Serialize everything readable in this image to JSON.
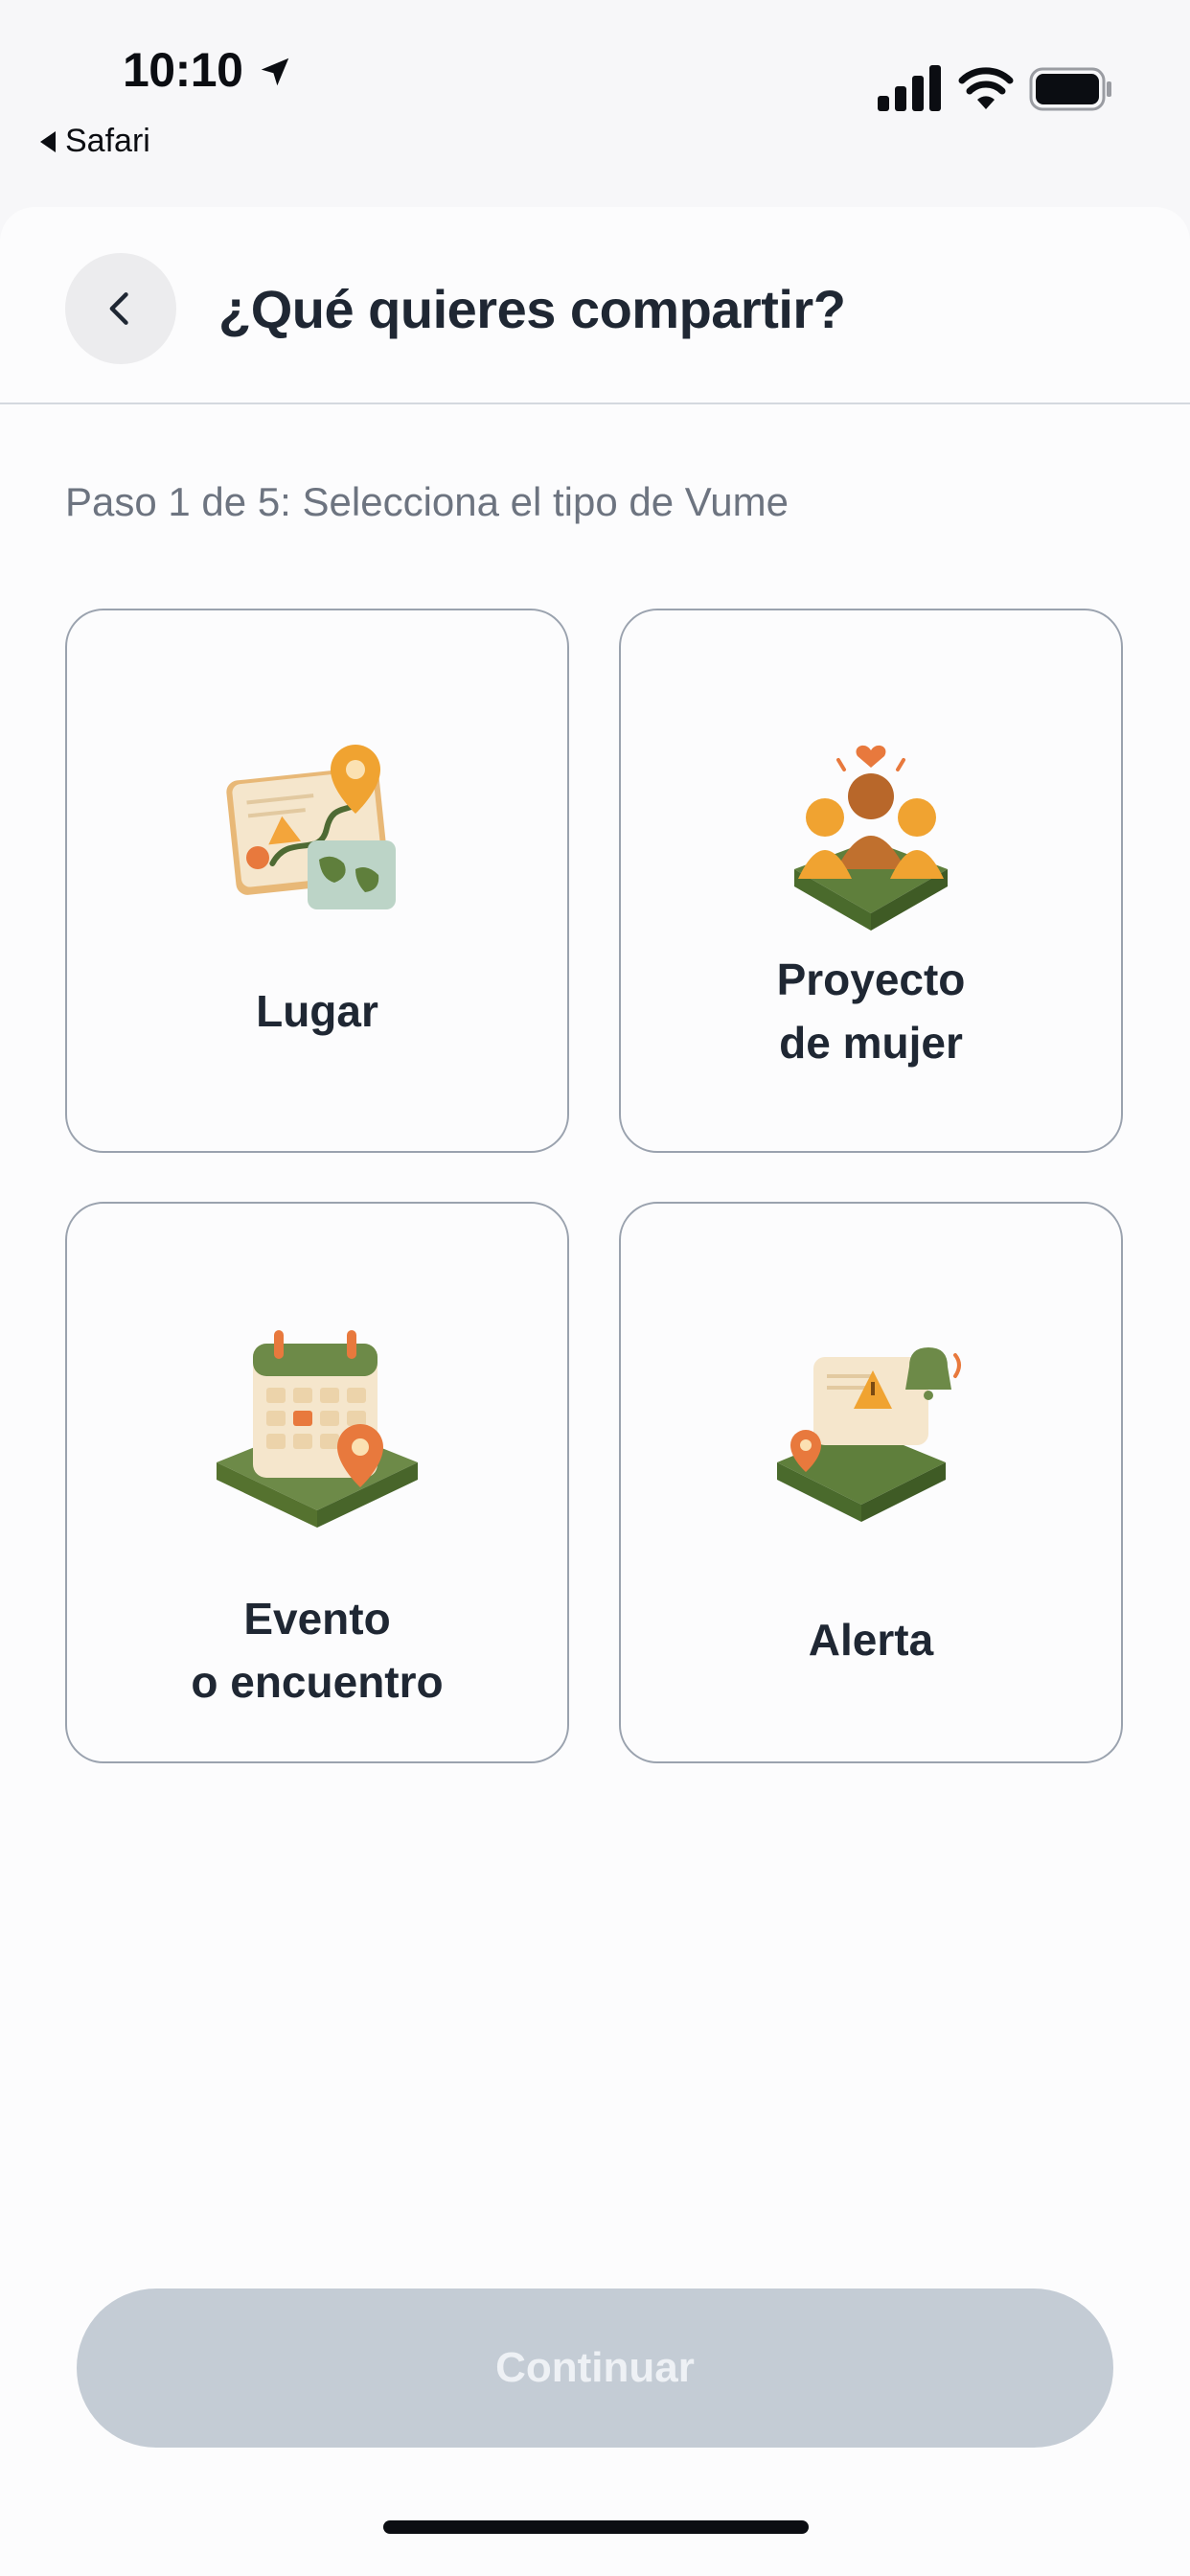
{
  "status_bar": {
    "time": "10:10",
    "back_app": "Safari",
    "icons": [
      "location-arrow-icon",
      "cellular-signal-icon",
      "wifi-icon",
      "battery-icon"
    ]
  },
  "header": {
    "title": "¿Qué quieres compartir?",
    "back_icon": "chevron-left-icon"
  },
  "step": {
    "text": "Paso 1 de 5: Selecciona el tipo de Vume"
  },
  "options": [
    {
      "label": "Lugar",
      "icon": "map-pin-illustration"
    },
    {
      "label": "Proyecto\nde mujer",
      "icon": "women-group-illustration"
    },
    {
      "label": "Evento\no encuentro",
      "icon": "calendar-illustration"
    },
    {
      "label": "Alerta",
      "icon": "alert-bell-illustration"
    }
  ],
  "continue_button": {
    "label": "Continuar",
    "state": "disabled"
  },
  "colors": {
    "background": "#f7f7f9",
    "card_border": "#9aa2ae",
    "title_text": "#1f2733",
    "button_disabled": "#c4ccd5",
    "accent_orange": "#e9962e",
    "accent_green": "#5f7f3c"
  }
}
